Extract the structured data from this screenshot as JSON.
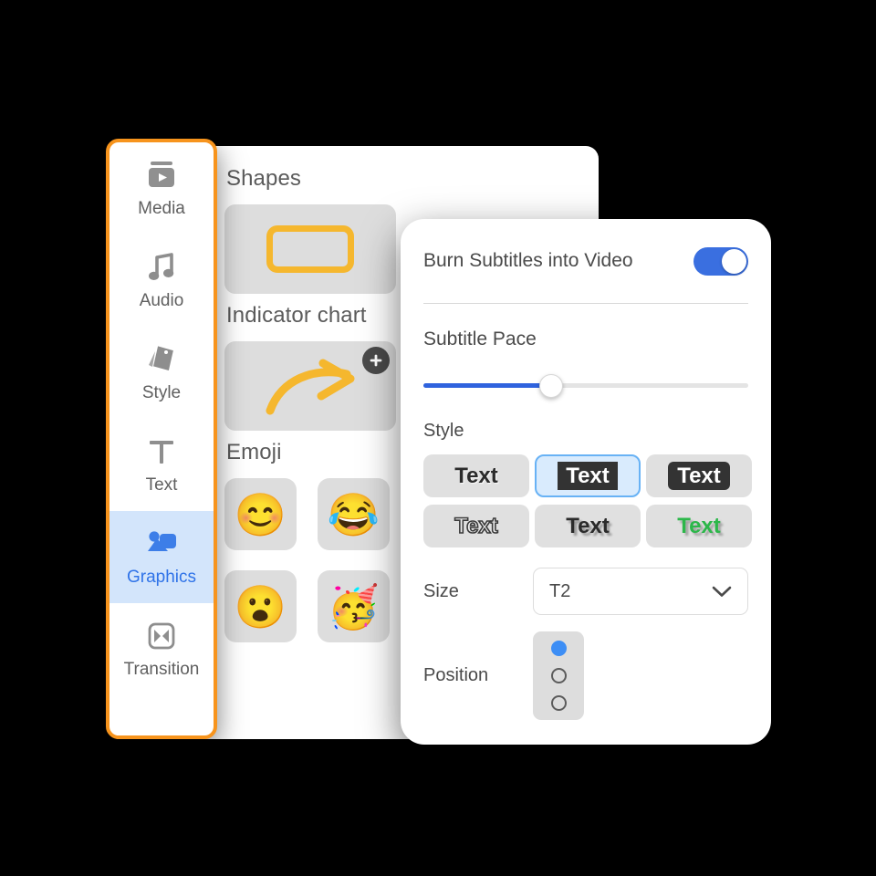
{
  "sidebar": {
    "items": [
      {
        "label": "Media",
        "icon": "media-icon",
        "active": false
      },
      {
        "label": "Audio",
        "icon": "audio-icon",
        "active": false
      },
      {
        "label": "Style",
        "icon": "style-icon",
        "active": false
      },
      {
        "label": "Text",
        "icon": "text-icon",
        "active": false
      },
      {
        "label": "Graphics",
        "icon": "graphics-icon",
        "active": true
      },
      {
        "label": "Transition",
        "icon": "transition-icon",
        "active": false
      }
    ],
    "highlight_color": "#f7941d",
    "active_bg": "#d3e5fb",
    "active_color": "#2f73e8"
  },
  "content_panel": {
    "sections": [
      {
        "title": "Shapes"
      },
      {
        "title": "Indicator chart"
      },
      {
        "title": "Emoji"
      }
    ],
    "shape_tile": {
      "name": "rounded-rectangle",
      "color": "#f5b72e"
    },
    "arrow_tile": {
      "name": "curved-arrow",
      "color": "#f5b72e",
      "badge": "+"
    },
    "emojis": [
      "😊",
      "😂",
      "😮",
      "🥳"
    ]
  },
  "dialog": {
    "burn_subtitles_label": "Burn Subtitles into Video",
    "burn_subtitles_on": true,
    "subtitle_pace_label": "Subtitle Pace",
    "subtitle_pace_percent": 39,
    "style_label": "Style",
    "style_options": [
      {
        "text": "Text",
        "variant": "plain",
        "selected": false
      },
      {
        "text": "Text",
        "variant": "boxed",
        "selected": true
      },
      {
        "text": "Text",
        "variant": "boxed-round",
        "selected": false
      },
      {
        "text": "Text",
        "variant": "outline",
        "selected": false
      },
      {
        "text": "Text",
        "variant": "shadow",
        "selected": false
      },
      {
        "text": "Text",
        "variant": "green",
        "selected": false
      }
    ],
    "size_label": "Size",
    "size_value": "T2",
    "position_label": "Position",
    "position_options": [
      "top",
      "middle",
      "bottom"
    ],
    "position_selected": 0,
    "accent_color": "#3a6fe0",
    "slider_color": "#2f63de"
  }
}
